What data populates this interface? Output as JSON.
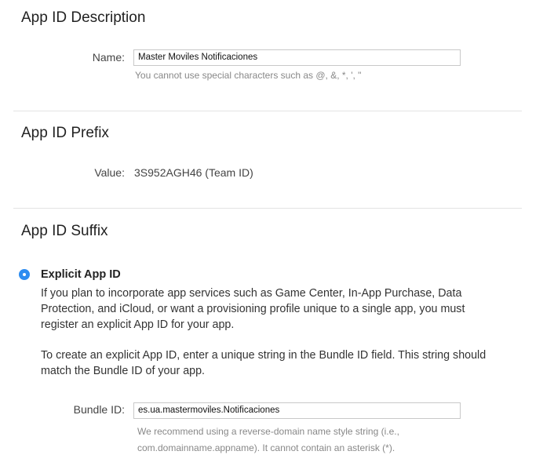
{
  "description": {
    "heading": "App ID Description",
    "name_label": "Name:",
    "name_value": "Master Moviles Notificaciones",
    "name_hint": "You cannot use special characters such as @, &, *, ', \""
  },
  "prefix": {
    "heading": "App ID Prefix",
    "value_label": "Value:",
    "value": "3S952AGH46 (Team ID)"
  },
  "suffix": {
    "heading": "App ID Suffix",
    "explicit": {
      "selected": true,
      "label": "Explicit App ID",
      "paragraph1": "If you plan to incorporate app services such as Game Center, In-App Purchase, Data Protection, and iCloud, or want a provisioning profile unique to a single app, you must register an explicit App ID for your app.",
      "paragraph2": "To create an explicit App ID, enter a unique string in the Bundle ID field. This string should match the Bundle ID of your app.",
      "bundle_label": "Bundle ID:",
      "bundle_value": "es.ua.mastermoviles.Notificaciones",
      "bundle_hint": "We recommend using a reverse-domain name style string (i.e., com.domainname.appname). It cannot contain an asterisk (*)."
    }
  },
  "colors": {
    "accent": "#2d8cf0"
  }
}
